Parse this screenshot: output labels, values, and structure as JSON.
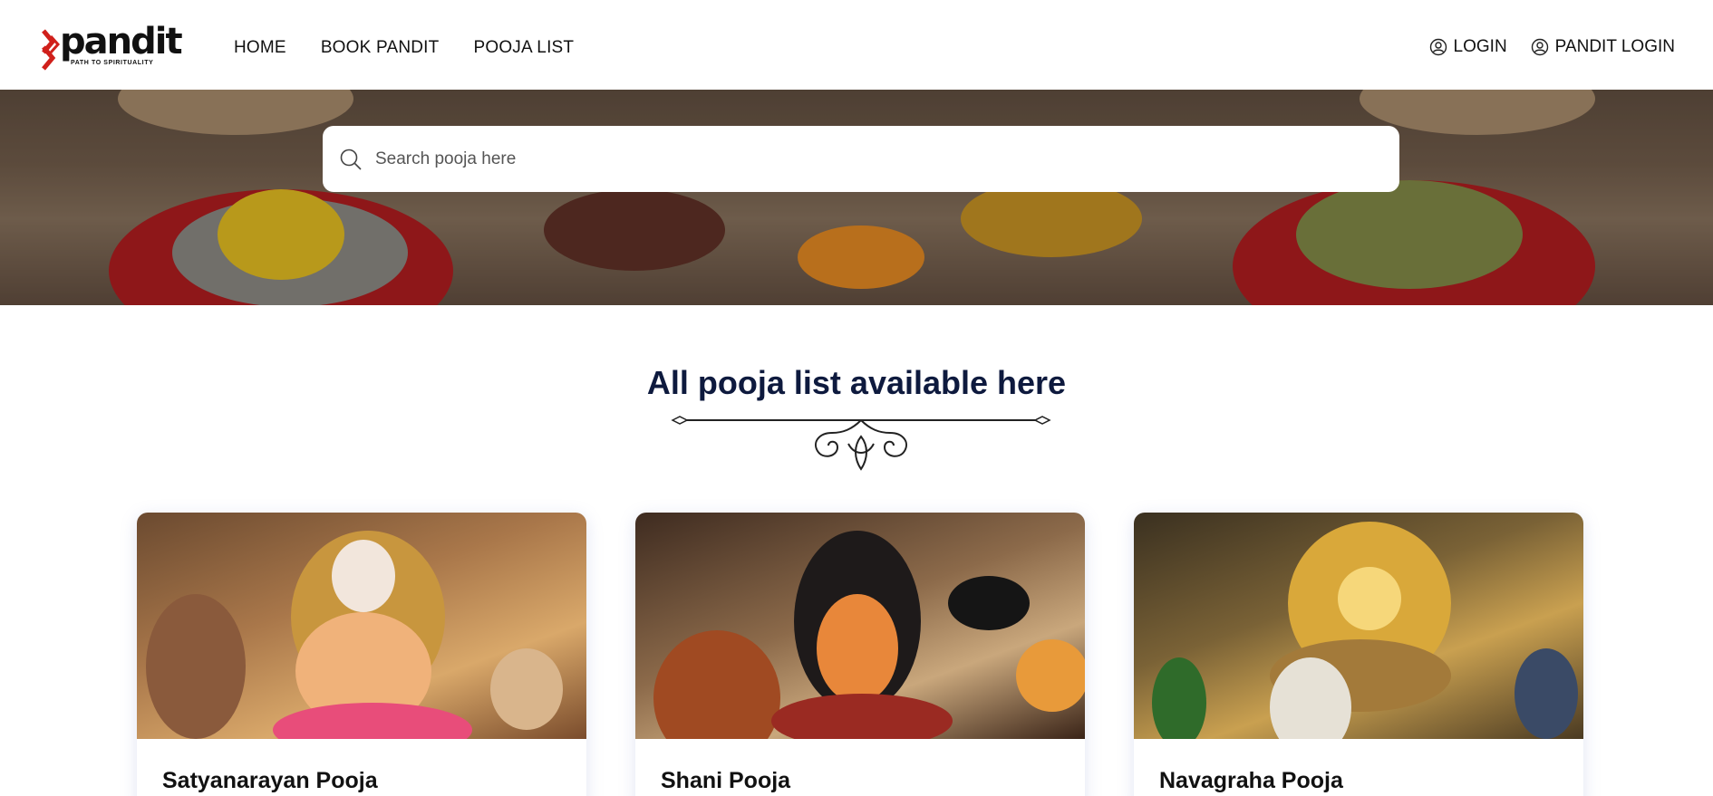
{
  "brand": {
    "logo_text": "pandit",
    "tagline": "PATH TO SPIRITUALITY",
    "accent_color": "#d0201b"
  },
  "nav": {
    "items": [
      {
        "label": "HOME"
      },
      {
        "label": "BOOK PANDIT"
      },
      {
        "label": "POOJA LIST"
      }
    ]
  },
  "auth": {
    "login_label": "LOGIN",
    "pandit_login_label": "PANDIT LOGIN",
    "icon": "user-circle-icon"
  },
  "search": {
    "placeholder": "Search pooja here",
    "icon": "search-icon"
  },
  "section": {
    "title": "All pooja list available here"
  },
  "cards": [
    {
      "title": "Satyanarayan Pooja"
    },
    {
      "title": "Shani Pooja"
    },
    {
      "title": "Navagraha Pooja"
    }
  ],
  "colors": {
    "title_color": "#0e1a3e",
    "text_color": "#111111"
  }
}
